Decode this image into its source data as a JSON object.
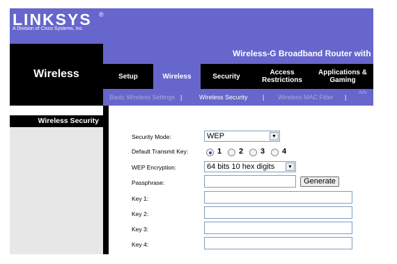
{
  "header": {
    "logo_text": "LINKSYS",
    "logo_reg": "®",
    "logo_subtitle": "A Division of Cisco Systems, Inc.",
    "product_name": "Wireless-G Broadband Router with Sp"
  },
  "section_title": "Wireless",
  "tabs": [
    {
      "label": "Setup"
    },
    {
      "label": "Wireless",
      "active": true
    },
    {
      "label": "Security"
    },
    {
      "label": "Access Restrictions"
    },
    {
      "label": "Applications & Gaming"
    }
  ],
  "subnav": {
    "items": [
      "Basic Wireless Settings",
      "Wireless Security",
      "Wireless MAC Filter",
      "Adv"
    ],
    "separator": "|",
    "active": "Wireless Security"
  },
  "sidebar": {
    "heading": "Wireless Security"
  },
  "form": {
    "security_mode": {
      "label": "Security Mode:",
      "value": "WEP"
    },
    "default_transmit_key": {
      "label": "Default Transmit  Key:",
      "options": [
        "1",
        "2",
        "3",
        "4"
      ],
      "selected": "1"
    },
    "wep_encryption": {
      "label": "WEP Encryption:",
      "value": "64 bits 10 hex digits"
    },
    "passphrase": {
      "label": "Passphrase:",
      "value": ""
    },
    "generate_label": "Generate",
    "key1": {
      "label": "Key 1:",
      "value": ""
    },
    "key2": {
      "label": "Key 2:",
      "value": ""
    },
    "key3": {
      "label": "Key 3:",
      "value": ""
    },
    "key4": {
      "label": "Key 4:",
      "value": ""
    }
  },
  "colors": {
    "brand_purple": "#6666cc",
    "header_black": "#000000",
    "sidebar_gray": "#e7e7e7",
    "subnav_dim": "#a9a9e0"
  },
  "icons": {
    "dropdown": "chevron-down-icon",
    "radio_selected": "radio-selected-icon",
    "radio_unselected": "radio-unselected-icon"
  }
}
